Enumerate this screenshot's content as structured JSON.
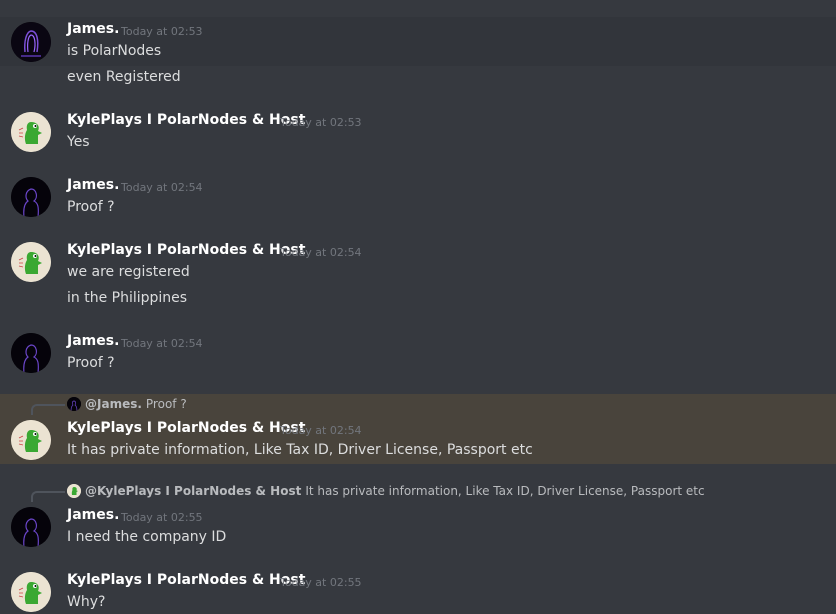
{
  "messages": [
    {
      "author": "James.",
      "time": "Today at 02:53",
      "lines": [
        "is PolarNodes",
        "even Registered"
      ]
    },
    {
      "author": "KylePlays I PolarNodes & Host",
      "time": "Today at 02:53",
      "lines": [
        "Yes"
      ]
    },
    {
      "author": "James.",
      "time": "Today at 02:54",
      "lines": [
        "Proof ?"
      ]
    },
    {
      "author": "KylePlays I PolarNodes & Host",
      "time": "Today at 02:54",
      "lines": [
        "we are registered",
        "in the Philippines"
      ]
    },
    {
      "author": "James.",
      "time": "Today at 02:54",
      "lines": [
        "Proof ?"
      ]
    },
    {
      "author": "KylePlays I PolarNodes & Host",
      "time": "Today at 02:54",
      "lines": [
        "It has private information, Like Tax ID, Driver License, Passport etc"
      ],
      "reply": {
        "name": "@James.",
        "text": "Proof ?"
      }
    },
    {
      "author": "James.",
      "time": "Today at 02:55",
      "lines": [
        "I need the company ID"
      ],
      "reply": {
        "name": "@KylePlays I PolarNodes & Host",
        "text": "It has private information, Like Tax ID, Driver License, Passport etc"
      }
    },
    {
      "author": "KylePlays I PolarNodes & Host",
      "time": "Today at 02:55",
      "lines": [
        "Why?"
      ]
    }
  ],
  "colors": {
    "background": "#36393f",
    "mention_highlight": "#49443c",
    "username": "#ffffff",
    "timestamp": "#72767d"
  }
}
